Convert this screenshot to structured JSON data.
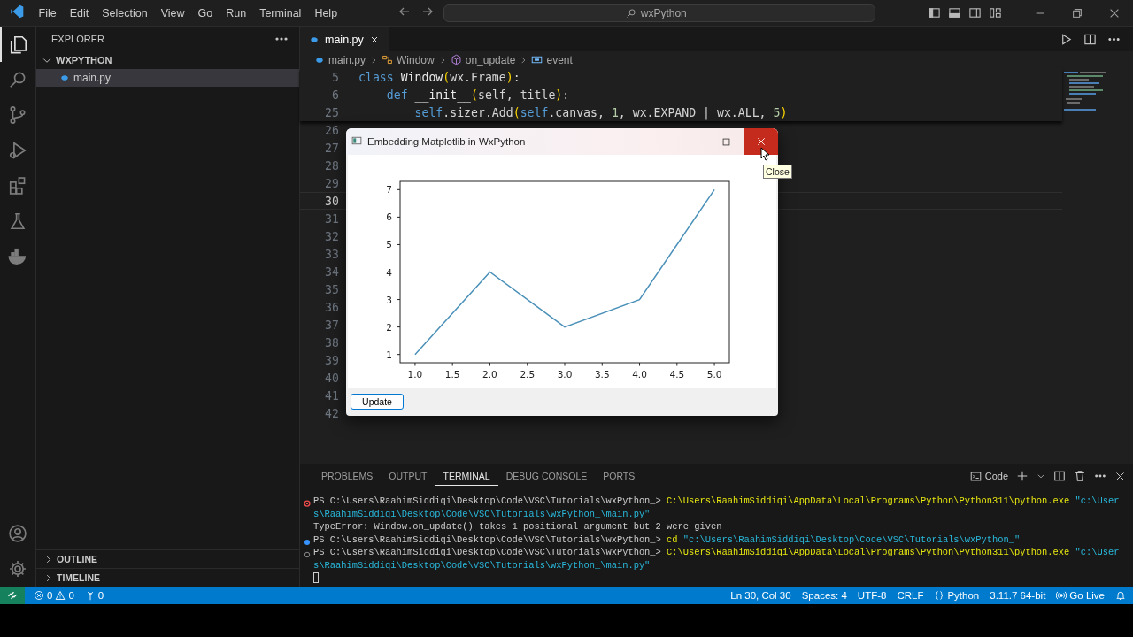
{
  "menu": [
    "File",
    "Edit",
    "Selection",
    "View",
    "Go",
    "Run",
    "Terminal",
    "Help"
  ],
  "command_center": {
    "text": "wxPython_"
  },
  "activity_bar": {
    "items": [
      {
        "selected": true
      },
      {
        "selected": false
      },
      {
        "selected": false
      },
      {
        "selected": false
      },
      {
        "selected": false
      },
      {
        "selected": false
      },
      {
        "selected": false
      }
    ]
  },
  "sidebar": {
    "title": "EXPLORER",
    "folder": {
      "name": "WXPYTHON_",
      "expanded": true,
      "children": [
        {
          "name": "main.py",
          "selected": true
        }
      ]
    },
    "sections": [
      {
        "name": "OUTLINE",
        "expanded": false
      },
      {
        "name": "TIMELINE",
        "expanded": false
      }
    ]
  },
  "editor": {
    "tabs": [
      {
        "label": "main.py",
        "selected": true
      }
    ],
    "breadcrumbs": [
      {
        "label": "main.py",
        "kind": "file"
      },
      {
        "label": "Window",
        "kind": "class"
      },
      {
        "label": "on_update",
        "kind": "method"
      },
      {
        "label": "event",
        "kind": "variable"
      }
    ],
    "sticky_lines": [
      {
        "number": "5",
        "tokens": [
          {
            "text": "class",
            "kind": "keyword"
          },
          {
            "text": " Window",
            "kind": "name"
          },
          {
            "text": "(",
            "kind": "paren"
          },
          {
            "text": "wx.Frame",
            "kind": "plain"
          },
          {
            "text": ")",
            "kind": "paren"
          },
          {
            "text": ":",
            "kind": "plain"
          }
        ]
      },
      {
        "number": "6",
        "tokens": [
          {
            "text": "    def",
            "kind": "keyword"
          },
          {
            "text": " __init__",
            "kind": "name"
          },
          {
            "text": "(",
            "kind": "paren"
          },
          {
            "text": "self, title",
            "kind": "plain"
          },
          {
            "text": ")",
            "kind": "paren"
          },
          {
            "text": ":",
            "kind": "plain"
          }
        ]
      },
      {
        "number": "25",
        "tokens": [
          {
            "text": "        self",
            "kind": "keyword"
          },
          {
            "text": ".sizer.Add",
            "kind": "plain"
          },
          {
            "text": "(",
            "kind": "paren"
          },
          {
            "text": "self",
            "kind": "keyword"
          },
          {
            "text": ".canvas, ",
            "kind": "plain"
          },
          {
            "text": "1",
            "kind": "number"
          },
          {
            "text": ", wx.EXPAND | wx.ALL, ",
            "kind": "plain"
          },
          {
            "text": "5",
            "kind": "number"
          },
          {
            "text": ")",
            "kind": "paren"
          }
        ]
      }
    ],
    "lines": [
      {
        "number": "26",
        "current": false
      },
      {
        "number": "27",
        "current": false
      },
      {
        "number": "28",
        "current": false
      },
      {
        "number": "29",
        "current": false
      },
      {
        "number": "30",
        "current": true
      },
      {
        "number": "31",
        "current": false
      },
      {
        "number": "32",
        "current": false
      },
      {
        "number": "33",
        "current": false
      },
      {
        "number": "34",
        "current": false
      },
      {
        "number": "35",
        "current": false
      },
      {
        "number": "36",
        "current": false
      },
      {
        "number": "37",
        "current": false
      },
      {
        "number": "38",
        "current": false
      },
      {
        "number": "39",
        "current": false
      },
      {
        "number": "40",
        "current": false
      },
      {
        "number": "41",
        "current": false
      },
      {
        "number": "42",
        "current": false
      }
    ]
  },
  "dialog": {
    "title": "Embedding Matplotlib in WxPython",
    "close_hovered": true,
    "tooltip": "Close",
    "button": "Update",
    "chart_data": {
      "type": "line",
      "x": [
        1,
        2,
        3,
        4,
        5
      ],
      "series": [
        {
          "color": "#4a90b8",
          "values": [
            1,
            4,
            2,
            3,
            7
          ]
        }
      ],
      "xlim": [
        0.8,
        5.2
      ],
      "ylim": [
        0.7,
        7.3
      ],
      "xticks": [
        {
          "value": 1,
          "label": "1.0"
        },
        {
          "value": 1.5,
          "label": "1.5"
        },
        {
          "value": 2,
          "label": "2.0"
        },
        {
          "value": 2.5,
          "label": "2.5"
        },
        {
          "value": 3,
          "label": "3.0"
        },
        {
          "value": 3.5,
          "label": "3.5"
        },
        {
          "value": 4,
          "label": "4.0"
        },
        {
          "value": 4.5,
          "label": "4.5"
        },
        {
          "value": 5,
          "label": "5.0"
        }
      ],
      "yticks": [
        1,
        2,
        3,
        4,
        5,
        6,
        7
      ]
    }
  },
  "panel": {
    "tabs": [
      {
        "label": "PROBLEMS",
        "selected": false
      },
      {
        "label": "OUTPUT",
        "selected": false
      },
      {
        "label": "TERMINAL",
        "selected": true
      },
      {
        "label": "DEBUG CONSOLE",
        "selected": false
      },
      {
        "label": "PORTS",
        "selected": false
      }
    ],
    "profile": "Code",
    "terminal": [
      {
        "kind": "failed",
        "prompt": "PS C:\\Users\\RaahimSiddiqi\\Desktop\\Code\\VSC\\Tutorials\\wxPython_>",
        "command": "C:\\Users\\RaahimSiddiqi\\AppData\\Local\\Programs\\Python\\Python311\\python.exe",
        "argument": "\"c:\\Users\\RaahimSiddiqi\\Desktop\\Code\\VSC\\Tutorials\\wxPython_\\main.py\""
      },
      {
        "kind": "output",
        "text": "TypeError: Window.on_update() takes 1 positional argument but 2 were given"
      },
      {
        "kind": "succeeded",
        "prompt": "PS C:\\Users\\RaahimSiddiqi\\Desktop\\Code\\VSC\\Tutorials\\wxPython_>",
        "command": "cd",
        "argument": "\"c:\\Users\\RaahimSiddiqi\\Desktop\\Code\\VSC\\Tutorials\\wxPython_\""
      },
      {
        "kind": "running",
        "prompt": "PS C:\\Users\\RaahimSiddiqi\\Desktop\\Code\\VSC\\Tutorials\\wxPython_>",
        "command": "C:\\Users\\RaahimSiddiqi\\AppData\\Local\\Programs\\Python\\Python311\\python.exe",
        "argument": "\"c:\\Users\\RaahimSiddiqi\\Desktop\\Code\\VSC\\Tutorials\\wxPython_\\main.py\""
      },
      {
        "kind": "cursor"
      }
    ]
  },
  "status_bar": {
    "errors": "0",
    "warnings": "0",
    "ports": "0",
    "items": [
      {
        "kind": "position",
        "text": "Ln 30, Col 30"
      },
      {
        "kind": "indent",
        "text": "Spaces: 4"
      },
      {
        "kind": "encoding",
        "text": "UTF-8"
      },
      {
        "kind": "eol",
        "text": "CRLF"
      },
      {
        "kind": "language",
        "text": "Python"
      },
      {
        "kind": "interpreter",
        "text": "3.11.7 64-bit"
      },
      {
        "kind": "live",
        "text": "Go Live"
      }
    ]
  }
}
